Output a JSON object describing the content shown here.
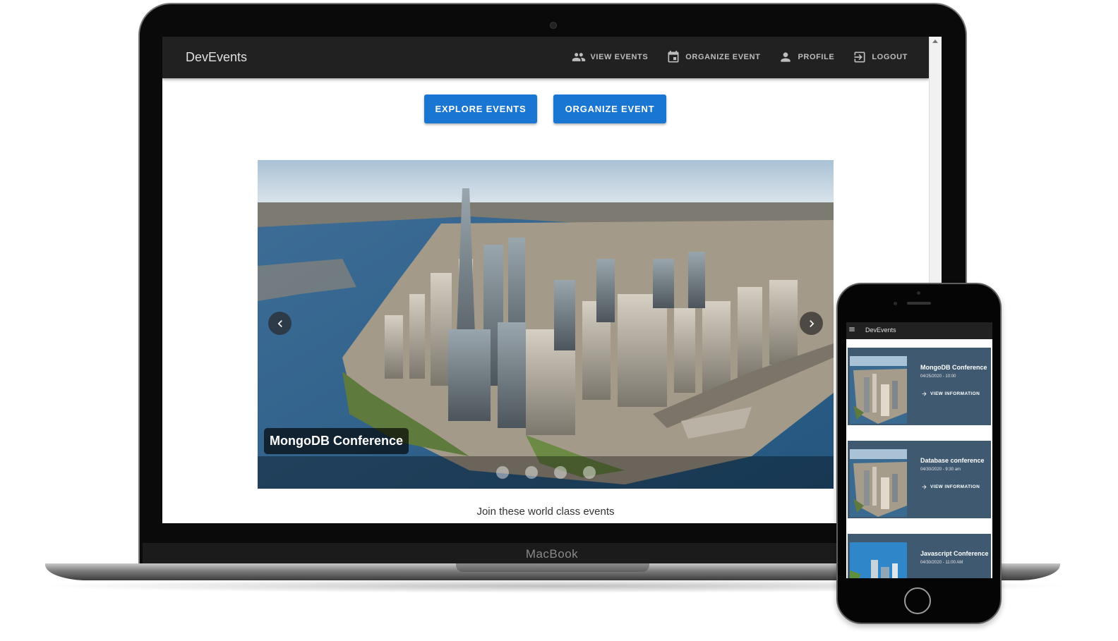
{
  "colors": {
    "appbar": "#212121",
    "primary": "#1976d2",
    "card": "#3e5970",
    "page_bg": "#ffffff"
  },
  "app": {
    "brand": "DevEvents",
    "nav": [
      {
        "label": "VIEW EVENTS",
        "icon": "people-icon"
      },
      {
        "label": "ORGANIZE EVENT",
        "icon": "calendar-icon"
      },
      {
        "label": "PROFILE",
        "icon": "person-icon"
      },
      {
        "label": "LOGOUT",
        "icon": "logout-icon"
      }
    ]
  },
  "hero": {
    "explore_label": "EXPLORE EVENTS",
    "organize_label": "ORGANIZE EVENT"
  },
  "carousel": {
    "caption": "MongoDB Conference",
    "slide_count": 4,
    "prev_icon": "chevron-left-icon",
    "next_icon": "chevron-right-icon"
  },
  "tagline": "Join these world class events",
  "device_label": "MacBook",
  "mobile": {
    "brand": "DevEvents",
    "menu_icon": "hamburger-icon",
    "cards": [
      {
        "title": "MongoDB Conference",
        "date": "04/25/2020 - 10:00",
        "link": "VIEW INFORMATION"
      },
      {
        "title": "Database conference",
        "date": "04/30/2020 - 9:30 am",
        "link": "VIEW INFORMATION"
      },
      {
        "title": "Javascript Conference",
        "date": "04/30/2020 - 11:00 AM",
        "link": ""
      }
    ]
  }
}
